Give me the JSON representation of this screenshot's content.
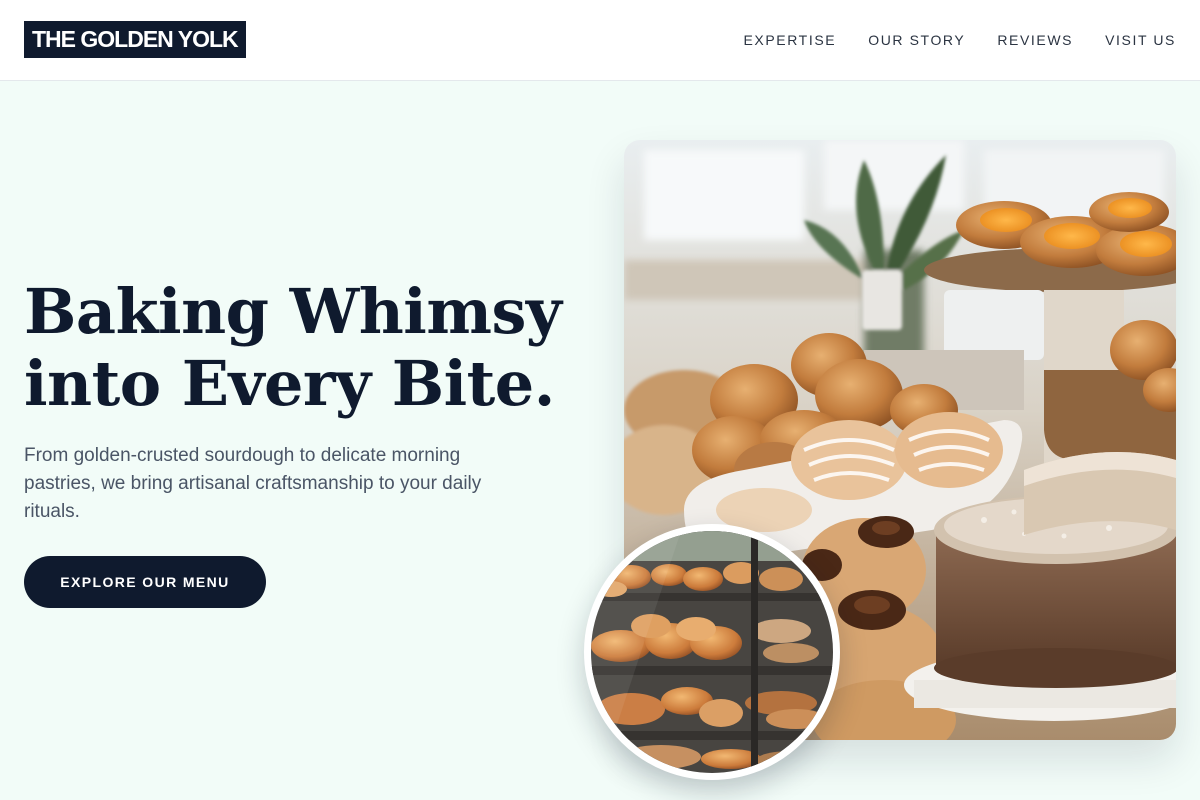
{
  "brand": {
    "name": "THE GOLDEN YOLK"
  },
  "nav": {
    "items": [
      {
        "label": "EXPERTISE"
      },
      {
        "label": "OUR STORY"
      },
      {
        "label": "REVIEWS"
      },
      {
        "label": "VISIT US"
      }
    ]
  },
  "hero": {
    "title_line1": "Baking Whimsy",
    "title_line2": "into Every Bite.",
    "subtitle": "From golden-crusted sourdough to delicate morning pastries, we bring artisanal craftsmanship to your daily rituals.",
    "cta_label": "EXPLORE OUR MENU"
  },
  "images": {
    "main": {
      "icon": "bakery-counter-photo"
    },
    "inset": {
      "icon": "pastry-display-case-photo"
    }
  },
  "colors": {
    "brand_navy": "#0f1a2e",
    "background_mint": "#f2fcf8",
    "text_muted": "#4a5566"
  }
}
